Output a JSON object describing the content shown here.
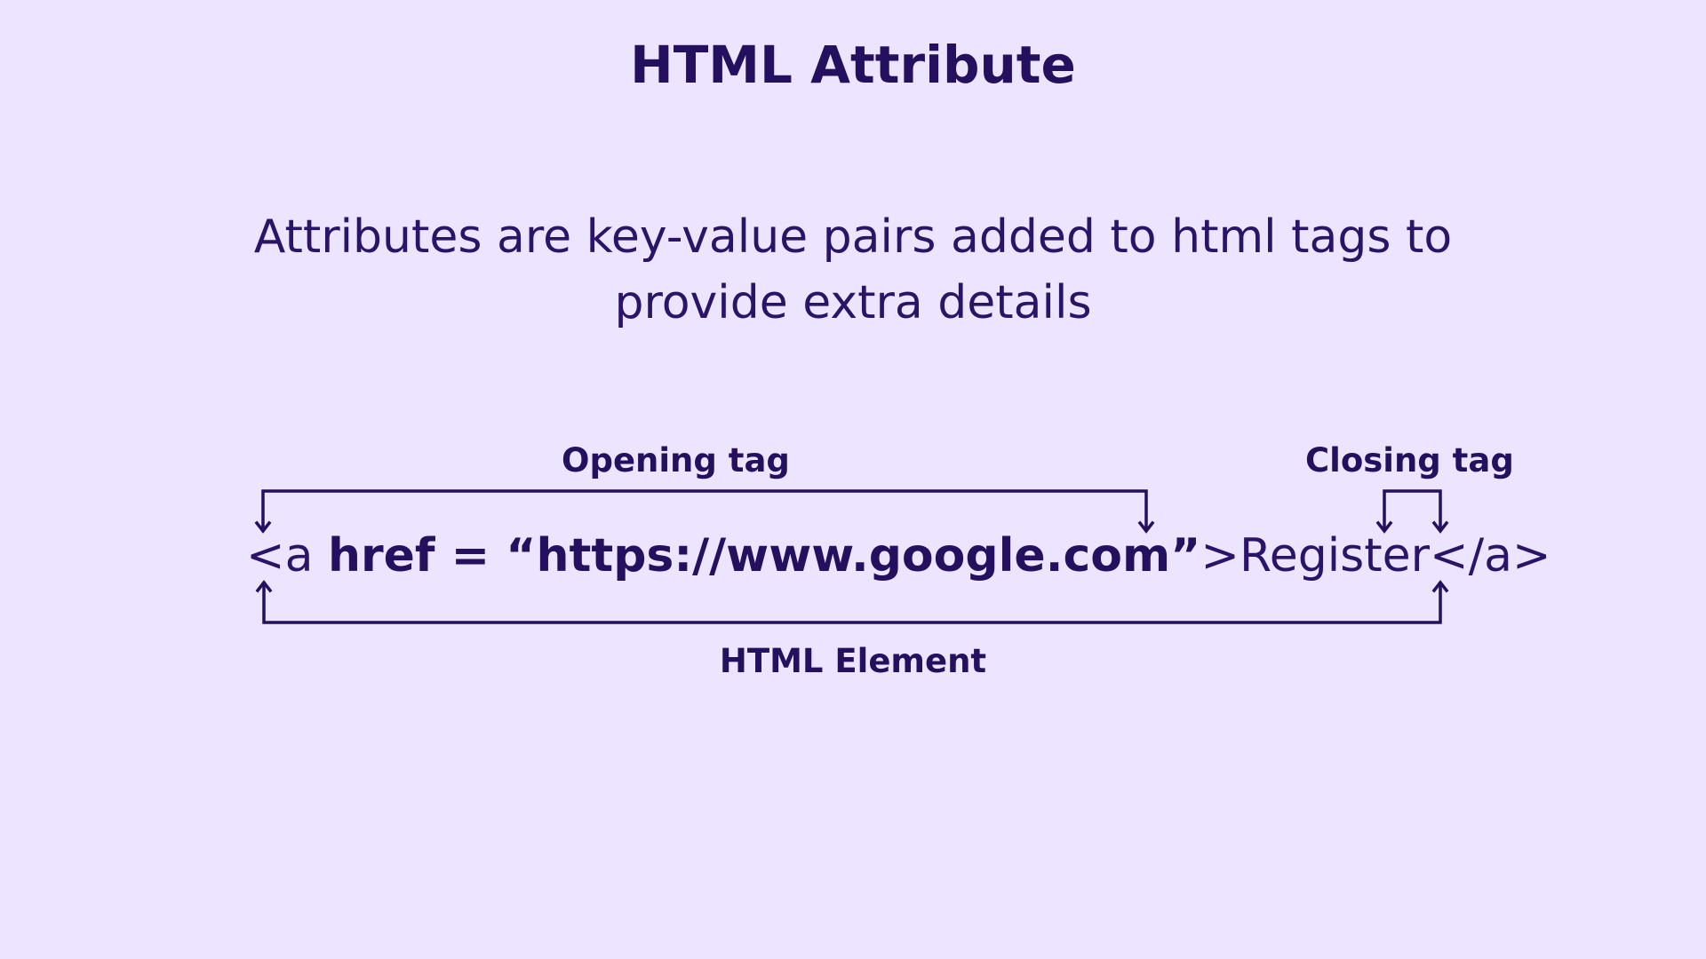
{
  "title": "HTML Attribute",
  "description": {
    "line1": "Attributes are key-value pairs added to html tags to",
    "line2": "provide extra details"
  },
  "code": {
    "open_start": "<a ",
    "attribute": "href = “https://www.google.com”",
    "open_end": ">",
    "content": "Register",
    "close_tag": "</a>"
  },
  "labels": {
    "opening_tag": "Opening tag",
    "closing_tag": "Closing tag",
    "html_element": "HTML Element"
  },
  "colors": {
    "background": "#ede5ff",
    "ink": "#24105e"
  }
}
